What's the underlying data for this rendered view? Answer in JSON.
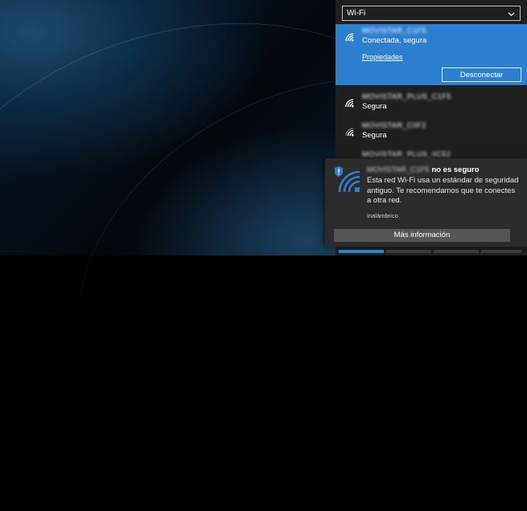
{
  "network_selector": {
    "value": "Wi-Fi"
  },
  "active_network": {
    "name": "MOVISTAR_C1F5",
    "status": "Conectada, segura",
    "properties_link": "Propiedades",
    "disconnect_label": "Desconectar"
  },
  "networks": [
    {
      "name": "MOVISTAR_PLUS_C1F5",
      "status": "Segura"
    },
    {
      "name": "MOVISTAR_C0F2",
      "status": "Segura"
    },
    {
      "name": "MOVISTAR_PLUS_0C52",
      "status": ""
    }
  ],
  "toast": {
    "network_name": "MOVISTAR_C1F5",
    "title_suffix": "no es seguro",
    "body": "Esta red Wi-Fi usa un estándar de seguridad antiguo. Te recomendamos que te conectes a otra red.",
    "source": "Inalámbrico",
    "action_label": "Más información"
  },
  "colors": {
    "accent": "#2d7fd0",
    "flyout_bg": "#1f1f1f",
    "toast_bg": "#2b2b2b"
  },
  "icons": [
    "wifi-icon",
    "chevron-down-icon",
    "shield-alert-icon"
  ]
}
